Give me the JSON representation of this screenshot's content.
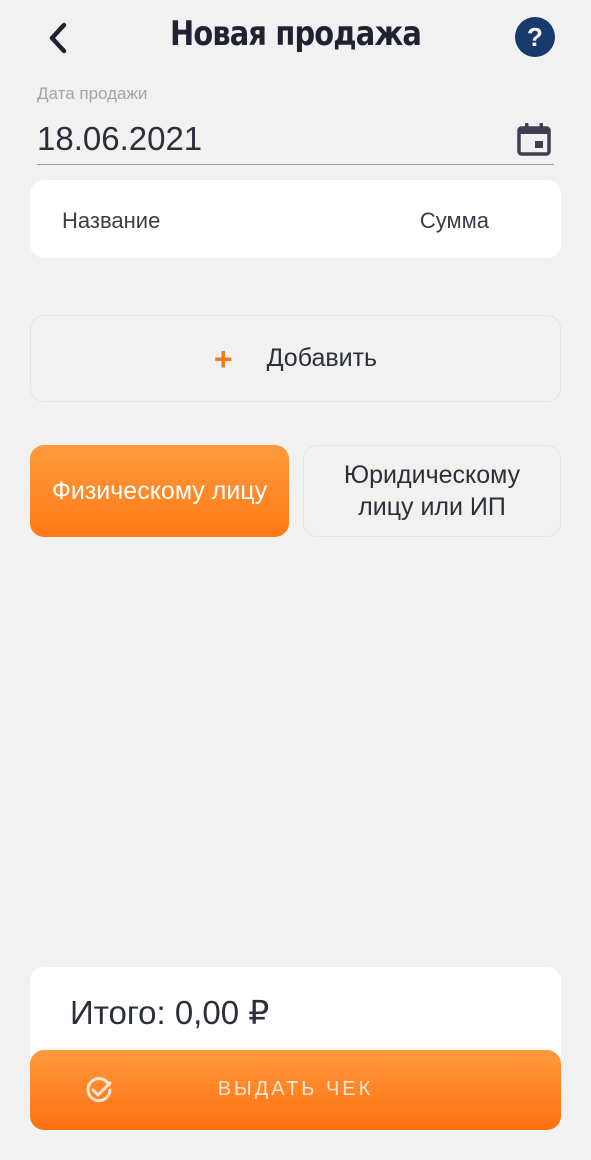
{
  "header": {
    "title": "Новая продажа",
    "back_icon": "chevron-left-icon",
    "help_icon": "question-circle-icon",
    "help_text": "?"
  },
  "date_field": {
    "label": "Дата продажи",
    "value": "18.06.2021",
    "icon": "calendar-icon"
  },
  "table": {
    "columns": [
      "Название",
      "Сумма"
    ]
  },
  "add_button": {
    "icon_text": "+",
    "label": "Добавить"
  },
  "buyer_type": {
    "options": [
      "Физическому лицу",
      "Юридическому лицу или ИП"
    ],
    "selected": "Физическому лицу"
  },
  "total": {
    "text": "Итого: 0,00 ₽"
  },
  "receipt_button": {
    "label": "ВЫДАТЬ ЧЕК",
    "icon": "check-circle-icon"
  },
  "colors": {
    "accent": "#ff7a15",
    "help_badge": "#163a6b",
    "background": "#f1f1f1"
  }
}
